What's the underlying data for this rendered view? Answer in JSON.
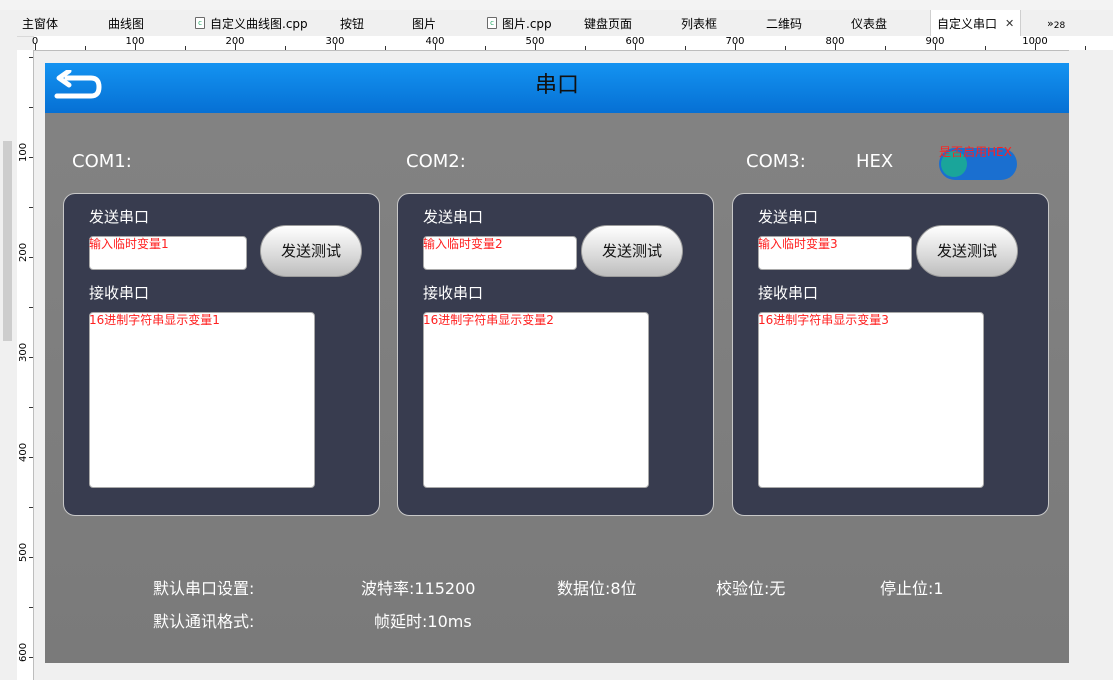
{
  "tabs": [
    {
      "label": "主窗体",
      "icon": "form-icon"
    },
    {
      "label": "曲线图",
      "icon": "form-icon"
    },
    {
      "label": "自定义曲线图.cpp",
      "icon": "cpp-file-icon"
    },
    {
      "label": "按钮",
      "icon": "form-icon"
    },
    {
      "label": "图片",
      "icon": "form-icon"
    },
    {
      "label": "图片.cpp",
      "icon": "cpp-file-icon"
    },
    {
      "label": "键盘页面",
      "icon": "form-icon"
    },
    {
      "label": "列表框",
      "icon": "form-icon"
    },
    {
      "label": "二维码",
      "icon": "form-icon"
    },
    {
      "label": "仪表盘",
      "icon": "form-icon"
    },
    {
      "label": "自定义串口",
      "icon": "form-icon",
      "active": true
    }
  ],
  "tab_overflow": {
    "arrow": "»",
    "count": "28"
  },
  "ruler": {
    "h_labels": [
      "0",
      "100",
      "200",
      "300",
      "400",
      "500",
      "600",
      "700",
      "800",
      "900",
      "1000"
    ],
    "v_labels": [
      "100",
      "200",
      "300",
      "400",
      "500",
      "600"
    ]
  },
  "form": {
    "title": "串口",
    "back_icon": "back-arrow-icon",
    "colors": {
      "titlebar": "#0a7fe0",
      "background": "#808080",
      "panel": "#383c4f",
      "hint_text": "#ff2020"
    },
    "hex": {
      "label": "HEX",
      "toggle_label": "是否启用HEX"
    },
    "ports": [
      {
        "name": "COM1:",
        "send_label": "发送串口",
        "send_placeholder": "输入临时变量1",
        "send_button": "发送测试",
        "recv_label": "接收串口",
        "recv_placeholder": "16进制字符串显示变量1"
      },
      {
        "name": "COM2:",
        "send_label": "发送串口",
        "send_placeholder": "输入临时变量2",
        "send_button": "发送测试",
        "recv_label": "接收串口",
        "recv_placeholder": "16进制字符串显示变量2"
      },
      {
        "name": "COM3:",
        "send_label": "发送串口",
        "send_placeholder": "输入临时变量3",
        "send_button": "发送测试",
        "recv_label": "接收串口",
        "recv_placeholder": "16进制字符串显示变量3"
      }
    ],
    "defaults": {
      "serial_title": "默认串口设置:",
      "baud": "波特率:115200",
      "data_bits": "数据位:8位",
      "parity": "校验位:无",
      "stop_bits": "停止位:1",
      "format_title": "默认通讯格式:",
      "frame_delay": "帧延时:10ms"
    }
  }
}
